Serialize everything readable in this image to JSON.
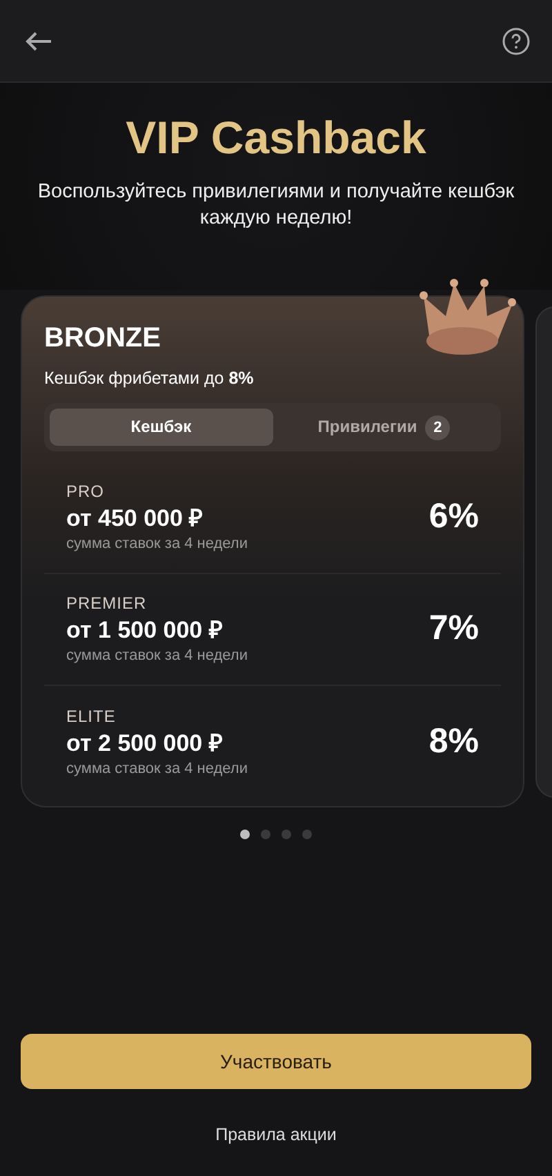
{
  "hero": {
    "title": "VIP Cashback",
    "subtitle": "Воспользуйтесь привилегиями и получайте кешбэк каждую неделю!"
  },
  "card": {
    "title": "BRONZE",
    "cashback_note": "Кешбэк фрибетами до **8%**",
    "tabs": [
      {
        "label": "Кешбэк",
        "selected": true
      },
      {
        "label": "Привилегии",
        "selected": false,
        "badge": "2"
      }
    ],
    "tiers": [
      {
        "name": "PRO",
        "amount": "от 450 000 ₽",
        "note": "сумма ставок за 4 недели",
        "percent": "6%"
      },
      {
        "name": "PREMIER",
        "amount": "от 1 500 000 ₽",
        "note": "сумма ставок за 4 недели",
        "percent": "7%"
      },
      {
        "name": "ELITE",
        "amount": "от 2 500 000 ₽",
        "note": "сумма ставок за 4 недели",
        "percent": "8%"
      }
    ]
  },
  "pager": [
    {
      "selected": true
    },
    {
      "selected": false
    },
    {
      "selected": false
    },
    {
      "selected": false
    }
  ],
  "join_button": "Участвовать",
  "rules_link": "Правила акции"
}
